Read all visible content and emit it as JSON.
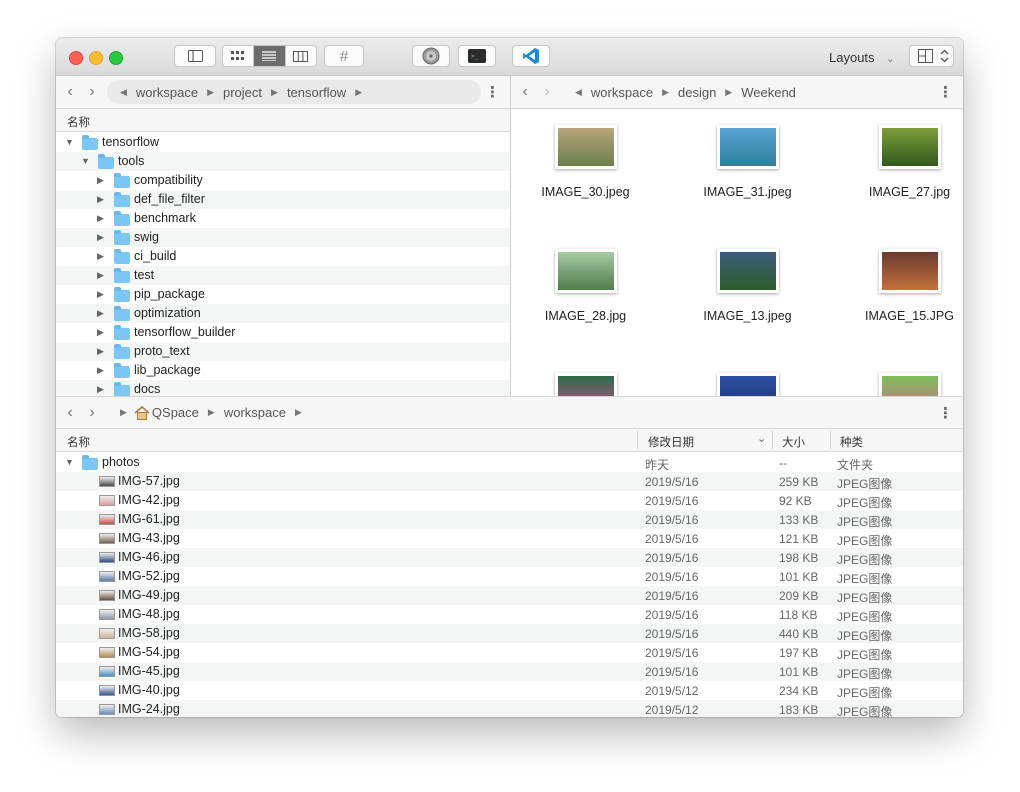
{
  "toolbar": {
    "layouts_label": "Layouts",
    "hash_label": "#"
  },
  "top_left": {
    "path": [
      "workspace",
      "project",
      "tensorflow"
    ],
    "column_name": "名称",
    "tree": [
      {
        "label": "tensorflow",
        "level": 0,
        "expanded": true
      },
      {
        "label": "tools",
        "level": 1,
        "expanded": true
      },
      {
        "label": "compatibility",
        "level": 2
      },
      {
        "label": "def_file_filter",
        "level": 2
      },
      {
        "label": "benchmark",
        "level": 2
      },
      {
        "label": "swig",
        "level": 2
      },
      {
        "label": "ci_build",
        "level": 2
      },
      {
        "label": "test",
        "level": 2
      },
      {
        "label": "pip_package",
        "level": 2
      },
      {
        "label": "optimization",
        "level": 2
      },
      {
        "label": "tensorflow_builder",
        "level": 2
      },
      {
        "label": "proto_text",
        "level": 2
      },
      {
        "label": "lib_package",
        "level": 2
      },
      {
        "label": "docs",
        "level": 2
      }
    ]
  },
  "top_right": {
    "path": [
      "workspace",
      "design",
      "Weekend"
    ],
    "images": [
      {
        "name": "IMAGE_30.jpeg",
        "c1": "#b9a57c",
        "c2": "#6b7f4d"
      },
      {
        "name": "IMAGE_31.jpeg",
        "c1": "#5aa3d6",
        "c2": "#2f7f9b"
      },
      {
        "name": "IMAGE_27.jpg",
        "c1": "#7d9c3b",
        "c2": "#2e5a1c"
      },
      {
        "name": "IMAGE_28.jpg",
        "c1": "#a8c9a6",
        "c2": "#4f7d4a"
      },
      {
        "name": "IMAGE_13.jpeg",
        "c1": "#3b5b7a",
        "c2": "#2f5d2a"
      },
      {
        "name": "IMAGE_15.JPG",
        "c1": "#6a3b2f",
        "c2": "#c4713c"
      },
      {
        "name": "",
        "c1": "#2f6b4a",
        "c2": "#c34f8a"
      },
      {
        "name": "",
        "c1": "#2d4fa3",
        "c2": "#1c2f6b"
      },
      {
        "name": "",
        "c1": "#7bbf5a",
        "c2": "#d66a8a"
      }
    ]
  },
  "bottom": {
    "path": [
      "QSpace",
      "workspace"
    ],
    "headers": {
      "name": "名称",
      "date": "修改日期",
      "size": "大小",
      "kind": "种类"
    },
    "folder": {
      "name": "photos",
      "date": "昨天",
      "size": "--",
      "kind": "文件夹"
    },
    "files": [
      {
        "name": "IMG-57.jpg",
        "date": "2019/5/16",
        "size": "259 KB",
        "kind": "JPEG图像",
        "color": "#4a4a4a"
      },
      {
        "name": "IMG-42.jpg",
        "date": "2019/5/16",
        "size": "92 KB",
        "kind": "JPEG图像",
        "color": "#d9a0a0"
      },
      {
        "name": "IMG-61.jpg",
        "date": "2019/5/16",
        "size": "133 KB",
        "kind": "JPEG图像",
        "color": "#c0554a"
      },
      {
        "name": "IMG-43.jpg",
        "date": "2019/5/16",
        "size": "121 KB",
        "kind": "JPEG图像",
        "color": "#7a5f4f"
      },
      {
        "name": "IMG-46.jpg",
        "date": "2019/5/16",
        "size": "198 KB",
        "kind": "JPEG图像",
        "color": "#2f4f7f"
      },
      {
        "name": "IMG-52.jpg",
        "date": "2019/5/16",
        "size": "101 KB",
        "kind": "JPEG图像",
        "color": "#5a7fa8"
      },
      {
        "name": "IMG-49.jpg",
        "date": "2019/5/16",
        "size": "209 KB",
        "kind": "JPEG图像",
        "color": "#6b4f3a"
      },
      {
        "name": "IMG-48.jpg",
        "date": "2019/5/16",
        "size": "118 KB",
        "kind": "JPEG图像",
        "color": "#8a9aa8"
      },
      {
        "name": "IMG-58.jpg",
        "date": "2019/5/16",
        "size": "440 KB",
        "kind": "JPEG图像",
        "color": "#d0b49a"
      },
      {
        "name": "IMG-54.jpg",
        "date": "2019/5/16",
        "size": "197 KB",
        "kind": "JPEG图像",
        "color": "#b58a4f"
      },
      {
        "name": "IMG-45.jpg",
        "date": "2019/5/16",
        "size": "101 KB",
        "kind": "JPEG图像",
        "color": "#4f8fbf"
      },
      {
        "name": "IMG-40.jpg",
        "date": "2019/5/12",
        "size": "234 KB",
        "kind": "JPEG图像",
        "color": "#3a5a8a"
      },
      {
        "name": "IMG-24.jpg",
        "date": "2019/5/12",
        "size": "183 KB",
        "kind": "JPEG图像",
        "color": "#6a8fb5"
      }
    ]
  }
}
